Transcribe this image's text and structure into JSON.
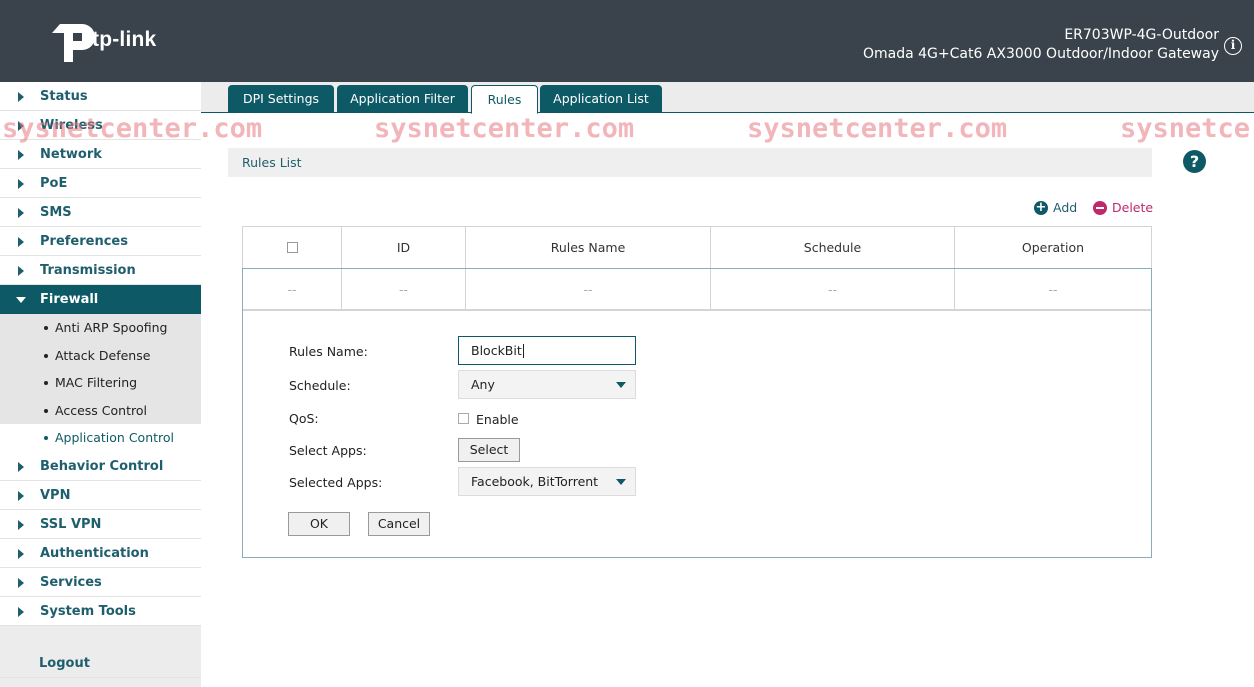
{
  "header": {
    "brand": "tp-link",
    "model_line1": "ER703WP-4G-Outdoor",
    "model_line2": "Omada 4G+Cat6 AX3000 Outdoor/Indoor Gateway",
    "info_icon": "info-icon"
  },
  "sidebar": {
    "items_top": [
      {
        "label": "Status"
      },
      {
        "label": "Wireless"
      },
      {
        "label": "Network"
      },
      {
        "label": "PoE"
      },
      {
        "label": "SMS"
      },
      {
        "label": "Preferences"
      },
      {
        "label": "Transmission"
      }
    ],
    "active": {
      "label": "Firewall"
    },
    "sub_items": [
      {
        "label": "Anti ARP Spoofing"
      },
      {
        "label": "Attack Defense"
      },
      {
        "label": "MAC Filtering"
      },
      {
        "label": "Access Control"
      },
      {
        "label": "Application Control"
      }
    ],
    "items_bottom": [
      {
        "label": "Behavior Control"
      },
      {
        "label": "VPN"
      },
      {
        "label": "SSL VPN"
      },
      {
        "label": "Authentication"
      },
      {
        "label": "Services"
      },
      {
        "label": "System Tools"
      }
    ],
    "logout": "Logout"
  },
  "tabs": [
    {
      "label": "DPI Settings"
    },
    {
      "label": "Application Filter"
    },
    {
      "label": "Rules"
    },
    {
      "label": "Application List"
    }
  ],
  "watermark": "sysnetcenter.com",
  "watermark_partial": "sysnetce",
  "section": {
    "title": "Rules List"
  },
  "actions": {
    "add": "Add",
    "delete": "Delete"
  },
  "table": {
    "headers": [
      "ID",
      "Rules Name",
      "Schedule",
      "Operation"
    ],
    "row": [
      "--",
      "--",
      "--",
      "--",
      "--"
    ]
  },
  "form": {
    "rules_name_label": "Rules Name:",
    "rules_name_value": "BlockBit",
    "schedule_label": "Schedule:",
    "schedule_value": "Any",
    "qos_label": "QoS:",
    "qos_option": "Enable",
    "select_apps_label": "Select Apps:",
    "select_button": "Select",
    "selected_apps_label": "Selected Apps:",
    "selected_apps_value": "Facebook, BitTorrent",
    "ok": "OK",
    "cancel": "Cancel"
  },
  "colors": {
    "header_bg": "#3a434b",
    "accent": "#0d5a66",
    "delete": "#c0286a"
  }
}
